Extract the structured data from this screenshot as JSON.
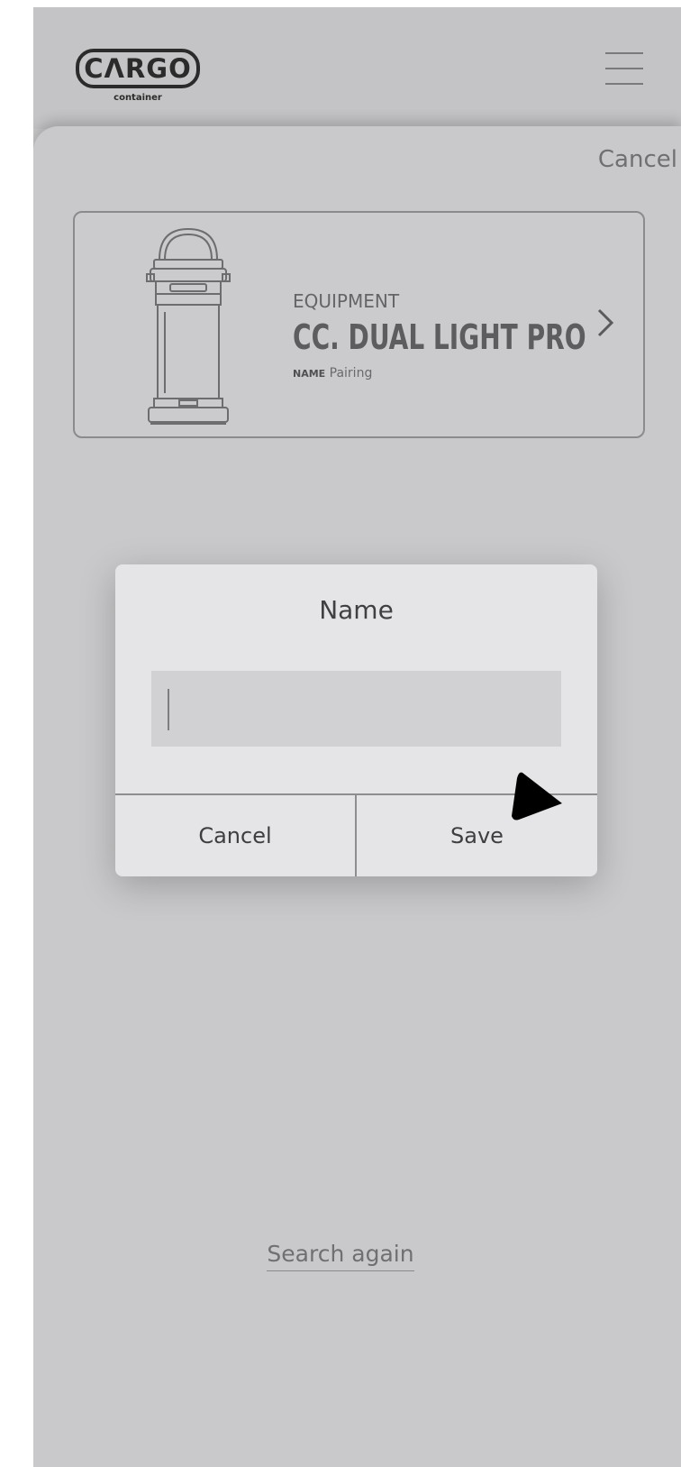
{
  "header": {
    "logo_text": "CΛRGO",
    "logo_subtext": "container",
    "menu_icon": "hamburger-menu-icon"
  },
  "sheet": {
    "cancel_label": "Cancel"
  },
  "equipment": {
    "kicker": "EQUIPMENT",
    "title": "CC. DUAL LIGHT PRO",
    "name_label": "NAME",
    "name_value": "Pairing",
    "image_icon": "lantern-icon",
    "chevron_icon": "chevron-right-icon"
  },
  "dialog": {
    "title": "Name",
    "input_value": "",
    "input_placeholder": "",
    "cancel_label": "Cancel",
    "save_label": "Save"
  },
  "footer": {
    "search_again_label": "Search again"
  },
  "colors": {
    "background": "#c9c9cb",
    "dialog": "#e5e5e7",
    "input": "#d1d1d3",
    "text_dark": "#404042",
    "text_muted": "#707072"
  }
}
